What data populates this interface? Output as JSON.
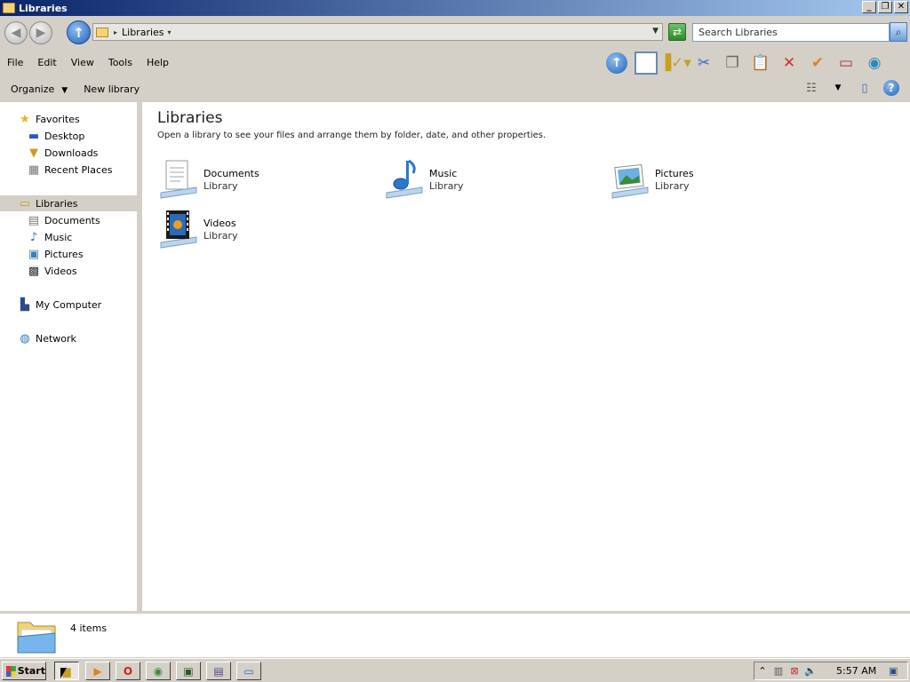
{
  "window": {
    "title": "Libraries",
    "controls": {
      "minimize": "_",
      "restore": "❐",
      "close": "✕"
    }
  },
  "address": {
    "crumb": "Libraries",
    "search_placeholder": "Search Libraries"
  },
  "menu": [
    "File",
    "Edit",
    "View",
    "Tools",
    "Help"
  ],
  "commands": {
    "organize": "Organize",
    "new_library": "New library"
  },
  "nav": {
    "favorites": "Favorites",
    "desktop": "Desktop",
    "downloads": "Downloads",
    "recent": "Recent Places",
    "libraries": "Libraries",
    "documents": "Documents",
    "music": "Music",
    "pictures": "Pictures",
    "videos": "Videos",
    "computer": "My Computer",
    "network": "Network"
  },
  "content": {
    "title": "Libraries",
    "description": "Open a library to see your files and arrange them by folder, date, and other properties.",
    "libraries": [
      {
        "name": "Documents",
        "type": "Library"
      },
      {
        "name": "Music",
        "type": "Library"
      },
      {
        "name": "Pictures",
        "type": "Library"
      },
      {
        "name": "Videos",
        "type": "Library"
      }
    ]
  },
  "status": {
    "count": "4 items"
  },
  "taskbar": {
    "start": "Start",
    "clock": "5:57 AM"
  }
}
